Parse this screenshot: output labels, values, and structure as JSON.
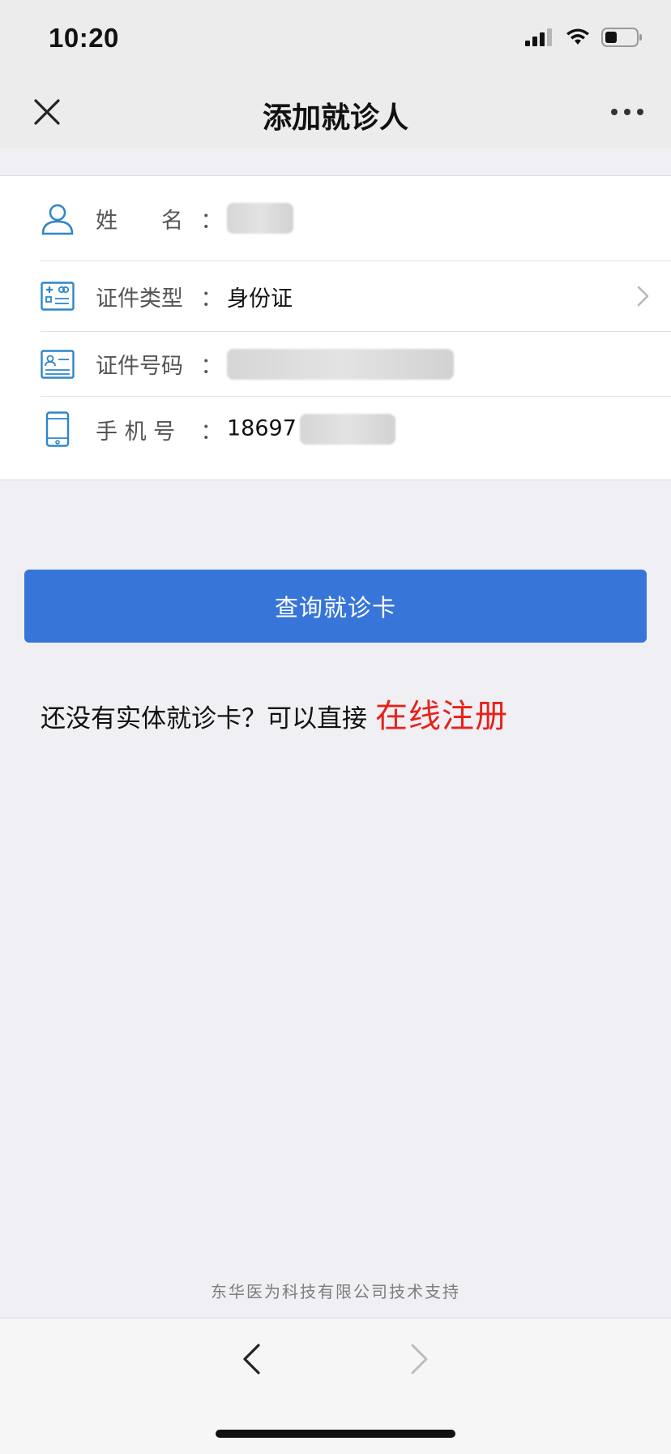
{
  "status_bar": {
    "time": "10:20"
  },
  "nav": {
    "title": "添加就诊人"
  },
  "form": {
    "rows": [
      {
        "label": "姓　　名",
        "value": "",
        "icon": "person-icon"
      },
      {
        "label": "证件类型",
        "value": "身份证",
        "icon": "id-card-icon"
      },
      {
        "label": "证件号码",
        "value": "",
        "icon": "id-number-icon"
      },
      {
        "label": "手 机 号",
        "value": "18697",
        "icon": "phone-icon"
      }
    ],
    "colon": "："
  },
  "query_button": {
    "label": "查询就诊卡"
  },
  "register": {
    "text": "还没有实体就诊卡？可以直接",
    "link": "在线注册"
  },
  "footer": {
    "text": "东华医为科技有限公司技术支持"
  },
  "colors": {
    "primary": "#3775d9",
    "link_red": "#e5231b",
    "icon_blue": "#2f86c8"
  }
}
